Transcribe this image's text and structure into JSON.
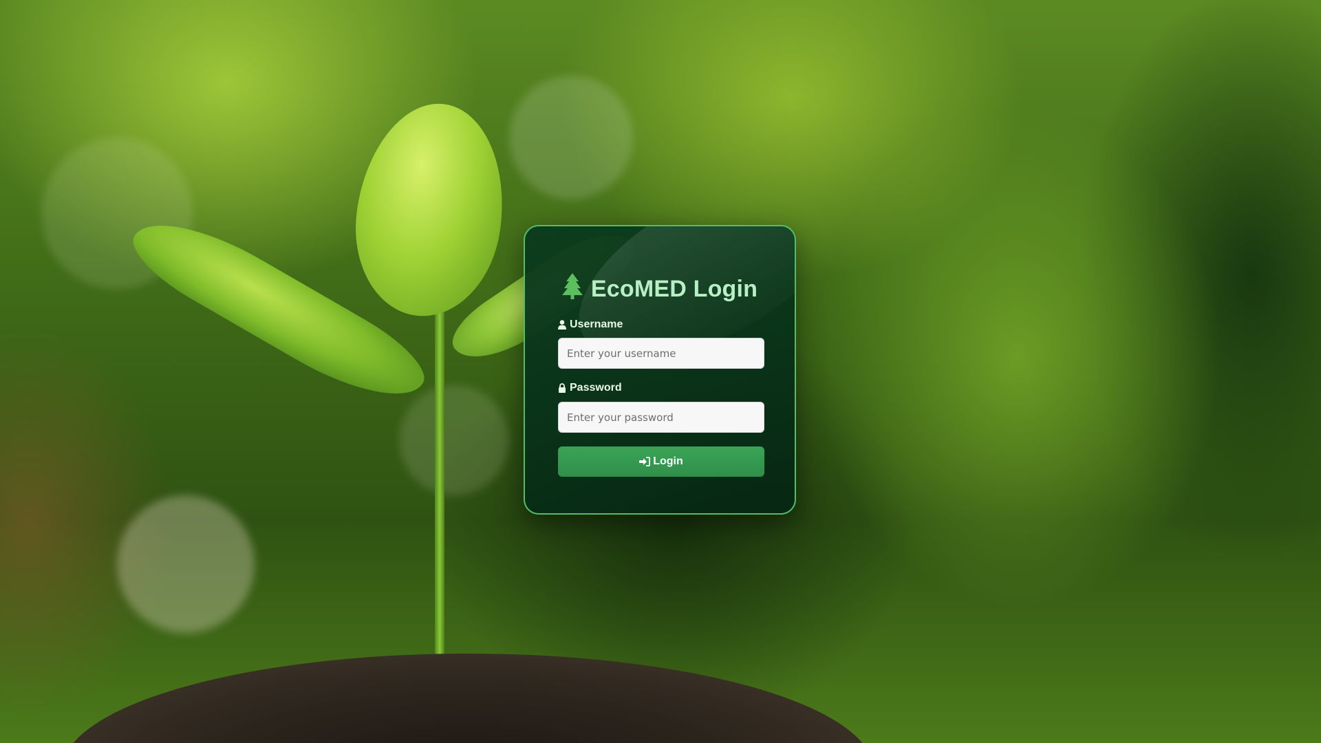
{
  "login": {
    "title": "EcoMED Login",
    "title_icon": "tree-icon",
    "username": {
      "label": "Username",
      "icon": "user-icon",
      "placeholder": "Enter your username",
      "value": ""
    },
    "password": {
      "label": "Password",
      "icon": "lock-icon",
      "placeholder": "Enter your password",
      "value": ""
    },
    "submit": {
      "label": "Login",
      "icon": "sign-in-icon"
    }
  },
  "colors": {
    "card_background": "#0a3a1e",
    "card_border": "#4fbf6a",
    "title_text": "#b7f0c4",
    "accent": "#3aa457",
    "tree_icon": "#5bbf5e"
  }
}
